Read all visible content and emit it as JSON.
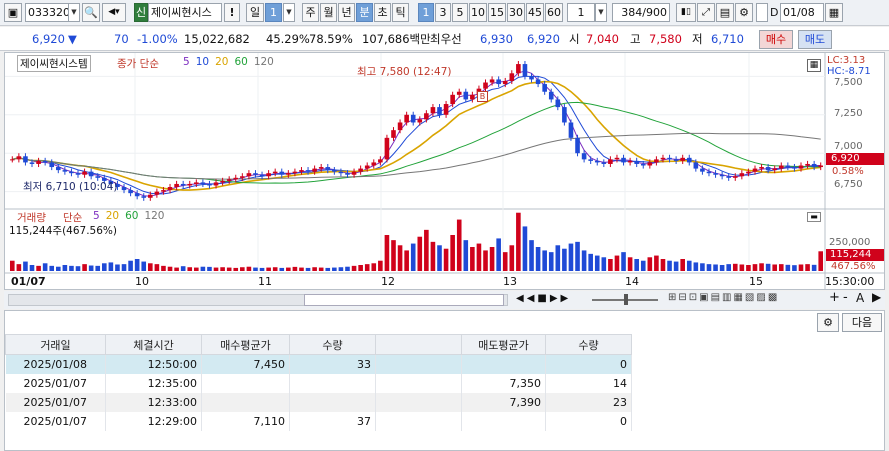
{
  "toolbar": {
    "code": "033320",
    "name": "제이씨현시스",
    "sin_badge": "신",
    "warn": "!",
    "period_sel": "일",
    "period_val": "1",
    "periods": [
      "주",
      "월",
      "년",
      "분",
      "초",
      "틱"
    ],
    "period_active": "분",
    "intervals": [
      "1",
      "3",
      "5",
      "10",
      "15",
      "30",
      "45",
      "60"
    ],
    "interval_active": "1",
    "count_val": "1",
    "pages": "384/900",
    "date_checkbox_label": "D",
    "date": "01/08"
  },
  "quote": {
    "price": "6,920",
    "arrow": "▼",
    "change": "70",
    "rate": "-1.00%",
    "volume": "15,022,682",
    "vol_ratio": "45.29%",
    "turnover": "78.59%",
    "amount": "107,686백만",
    "best_ask_label": "최우선",
    "best_ask": "6,930",
    "best_bid": "6,920",
    "open_label": "시",
    "open": "7,040",
    "high_label": "고",
    "high": "7,580",
    "low_label": "저",
    "low": "6,710",
    "buy_label": "매수",
    "sell_label": "매도"
  },
  "chart": {
    "legend_name": "제이씨현시스템",
    "legend_type": "종가 단순",
    "ma": [
      {
        "label": "5",
        "color": "#7b2cbf"
      },
      {
        "label": "10",
        "color": "#1f4ad6"
      },
      {
        "label": "20",
        "color": "#d9a400"
      },
      {
        "label": "60",
        "color": "#22a33a"
      },
      {
        "label": "120",
        "color": "#777777"
      }
    ],
    "high_note": "최고 7,580 (12:47)",
    "low_note": "최저 6,710 (10:04)",
    "b_marker": "B",
    "lc": "LC:3.13",
    "hc": "HC:-8.71",
    "price_ticks": [
      "7,500",
      "7,250",
      "7,000",
      "6,750"
    ],
    "price_tag": "6,920",
    "pct_tag": "0.58%",
    "vol_legend": "거래량",
    "vol_type": "단순",
    "vol_ma": [
      {
        "label": "5",
        "color": "#7b2cbf"
      },
      {
        "label": "20",
        "color": "#d9a400"
      },
      {
        "label": "60",
        "color": "#22a33a"
      },
      {
        "label": "120",
        "color": "#777777"
      }
    ],
    "vol_info": "115,244주(467.56%)",
    "vol_tick": "250,000",
    "vol_tag": "115,244",
    "vol_pct": "467.56%",
    "x_labels": [
      "01/07",
      "10",
      "11",
      "12",
      "13",
      "14",
      "15"
    ],
    "time_label": "15:30:00",
    "price_range": [
      6650,
      7600
    ],
    "vol_max": 350000,
    "price_series": [
      6960,
      6980,
      6940,
      6930,
      6950,
      6940,
      6910,
      6890,
      6880,
      6870,
      6860,
      6880,
      6850,
      6840,
      6820,
      6800,
      6780,
      6760,
      6740,
      6720,
      6710,
      6730,
      6750,
      6760,
      6780,
      6800,
      6790,
      6800,
      6810,
      6800,
      6790,
      6810,
      6820,
      6830,
      6840,
      6850,
      6870,
      6860,
      6850,
      6870,
      6880,
      6860,
      6870,
      6880,
      6890,
      6880,
      6900,
      6910,
      6890,
      6880,
      6870,
      6860,
      6880,
      6900,
      6920,
      6940,
      6960,
      7100,
      7150,
      7200,
      7250,
      7200,
      7220,
      7260,
      7300,
      7250,
      7320,
      7380,
      7400,
      7350,
      7380,
      7420,
      7460,
      7480,
      7450,
      7470,
      7520,
      7580,
      7500,
      7480,
      7450,
      7400,
      7350,
      7300,
      7200,
      7100,
      7000,
      6960,
      6950,
      6940,
      6930,
      6960,
      6970,
      6940,
      6950,
      6930,
      6920,
      6940,
      6960,
      6970,
      6960,
      6950,
      6970,
      6940,
      6900,
      6880,
      6870,
      6860,
      6850,
      6840,
      6850,
      6870,
      6880,
      6900,
      6910,
      6890,
      6900,
      6920,
      6910,
      6900,
      6920,
      6930,
      6910,
      6920
    ],
    "volume_series": [
      60,
      40,
      55,
      35,
      30,
      45,
      30,
      25,
      35,
      30,
      28,
      40,
      32,
      30,
      45,
      50,
      38,
      40,
      60,
      70,
      55,
      45,
      40,
      30,
      25,
      20,
      28,
      22,
      20,
      25,
      24,
      20,
      22,
      20,
      18,
      22,
      25,
      20,
      18,
      20,
      22,
      18,
      20,
      24,
      20,
      18,
      22,
      20,
      18,
      20,
      22,
      25,
      30,
      35,
      40,
      45,
      60,
      210,
      180,
      150,
      120,
      160,
      200,
      240,
      170,
      150,
      130,
      210,
      300,
      180,
      140,
      160,
      120,
      140,
      190,
      110,
      150,
      340,
      260,
      180,
      140,
      120,
      110,
      150,
      130,
      160,
      170,
      120,
      100,
      90,
      80,
      70,
      90,
      110,
      80,
      70,
      60,
      80,
      90,
      70,
      60,
      55,
      70,
      60,
      50,
      45,
      40,
      38,
      35,
      40,
      42,
      38,
      35,
      40,
      45,
      42,
      38,
      40,
      36,
      34,
      38,
      40,
      36,
      115
    ]
  },
  "controls": {
    "plus": "+",
    "minus": "-",
    "lock": "A",
    "next_button": "다음"
  },
  "trades": {
    "headers": [
      "거래일",
      "체결시간",
      "매수평균가",
      "수량",
      "",
      "매도평균가",
      "수량"
    ],
    "rows": [
      [
        "2025/01/08",
        "12:50:00",
        "7,450",
        "33",
        "",
        "",
        "0"
      ],
      [
        "2025/01/07",
        "12:35:00",
        "",
        "",
        "",
        "7,350",
        "14"
      ],
      [
        "2025/01/07",
        "12:33:00",
        "",
        "",
        "",
        "7,390",
        "23"
      ],
      [
        "2025/01/07",
        "12:29:00",
        "7,110",
        "37",
        "",
        "",
        "0"
      ]
    ]
  },
  "colors": {
    "up": "#d0021b",
    "down": "#1f4ad6",
    "accent": "#6f9fd8"
  }
}
